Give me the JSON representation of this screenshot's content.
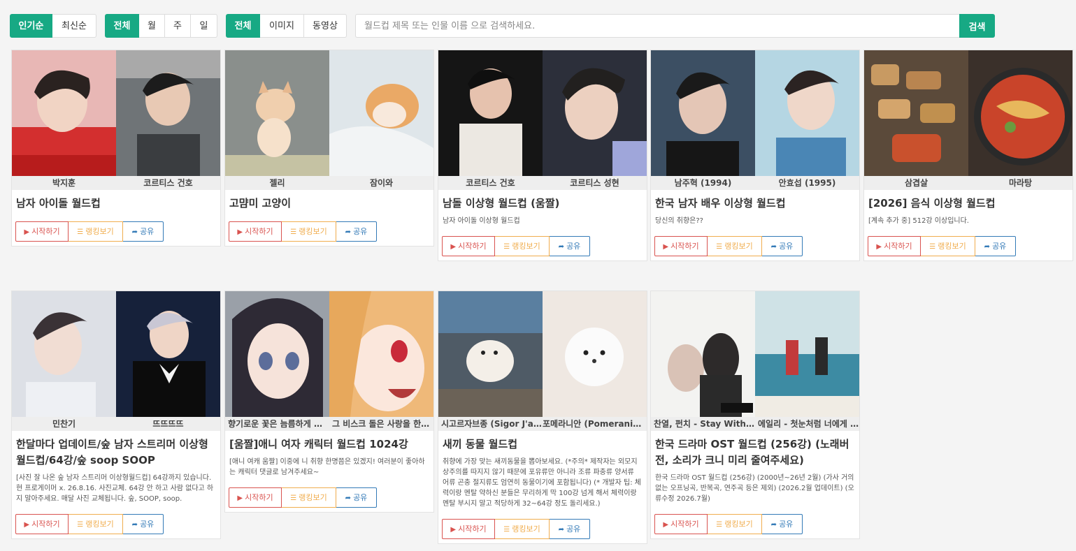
{
  "filters": {
    "sort": [
      "인기순",
      "최신순"
    ],
    "period": [
      "전체",
      "월",
      "주",
      "일"
    ],
    "media": [
      "전체",
      "이미지",
      "동영상"
    ],
    "search_placeholder": "월드컵 제목 또는 인물 이름 으로 검색하세요.",
    "search_label": "검색"
  },
  "actions": {
    "start": "시작하기",
    "ranking": "랭킹보기",
    "share": "공유"
  },
  "cards": [
    {
      "left_name": "박지훈",
      "right_name": "코르티스 건호",
      "title": "남자 아이돌 월드컵",
      "desc": "",
      "left_thumb": "idol-red-hoodie",
      "right_thumb": "idol-stage"
    },
    {
      "left_name": "젤리",
      "right_name": "잠이와",
      "title": "고먐미 고양이",
      "desc": "",
      "left_thumb": "kitten-standing",
      "right_thumb": "kitten-blanket"
    },
    {
      "left_name": "코르티스 건호",
      "right_name": "코르티스 성현",
      "title": "남돌 이상형 월드컵 (움짤)",
      "desc": "남자 아이돌 이상형 월드컵",
      "left_thumb": "idol-mic",
      "right_thumb": "idol-closeup"
    },
    {
      "left_name": "남주혁 (1994)",
      "right_name": "안효섭 (1995)",
      "title": "한국 남자 배우 이상형 월드컵",
      "desc": "당신의 취향은??",
      "left_thumb": "actor-dark",
      "right_thumb": "actor-light"
    },
    {
      "left_name": "삼겹살",
      "right_name": "마라탕",
      "title": "[2026] 음식 이상형 월드컵",
      "desc": "[계속 추가 중] 512강 이상입니다.",
      "left_thumb": "pork-belly",
      "right_thumb": "malatang"
    },
    {
      "left_name": "민찬기",
      "right_name": "뜨뜨뜨뜨",
      "title": "한달마다 업데이트/숲 남자 스트리머 이상형월드컵/64강/숲 soop SOOP",
      "desc": "[사진 잘 나온 숲 남자 스트리머 이상형월드컵] 64강까지 있습니다. 현 프로게이머 x. 26.8.16. 사진교체. 64강 안 하고 사람 없다고 하지 말아주세요. 매달 사진 교체됩니다. 숲, SOOP, soop.",
      "left_thumb": "streamer",
      "right_thumb": "tuxedo"
    },
    {
      "left_name": "향기로운 꽃은 늠름하게 핀...",
      "right_name": "그 비스크 돌은 사랑을 한다...",
      "title": "[움짤]애니 여자 캐릭터 월드컵 1024강",
      "desc": "[애니 여캐 움짤] 이중에 니 취향 한명쯤은 있겠지!   여러분이 좋아하는 캐릭터 댓글로 남겨주세요~",
      "left_thumb": "anime-dark-hair",
      "right_thumb": "anime-blonde"
    },
    {
      "left_name": "시고르자브종 (Sigor J'ab...",
      "right_name": "포메라니안 (Pomeranian)",
      "title": "새끼 동물 월드컵",
      "desc": "취향에 가장 맞는 새끼동물을 뽑아보세요. (*주의* 제작자는 외모지상주의를 따지지 않기 때문에 포유류만 아니라 조류 파충류 양서류 어류 곤충 절지류도 엄연히 동물이기에 포함됩니다) (* 개발자 팁: 체력이랑 멘탈 약하신 분들은 무리하게 막 100강 넘게 해서 체력이랑 멘탈 부시지 말고 적당하게 32~64강 정도 돌리세요.)",
      "left_thumb": "white-dog",
      "right_thumb": "pomeranian"
    },
    {
      "left_name": "찬열, 펀치 - Stay With M...",
      "right_name": "에일리 - 첫눈처럼 너에게 ...",
      "title": "한국 드라마 OST 월드컵 (256강) (노래버전, 소리가 크니 미리 줄여주세요)",
      "desc": "한국 드라마 OST 월드컵 (256강) (2000년~26년 2월) (가사 거의 없는 오프닝곡, 반복곡, 연주곡 등은 제외) (2026.2월 업데이트) (오류수정 2026.7월)",
      "left_thumb": "drama-poster-winter",
      "right_thumb": "drama-poster-sea"
    }
  ],
  "colors": {
    "accent": "#17a984",
    "start": "#d9534f",
    "ranking": "#f0ad4e",
    "share": "#337ab7"
  }
}
